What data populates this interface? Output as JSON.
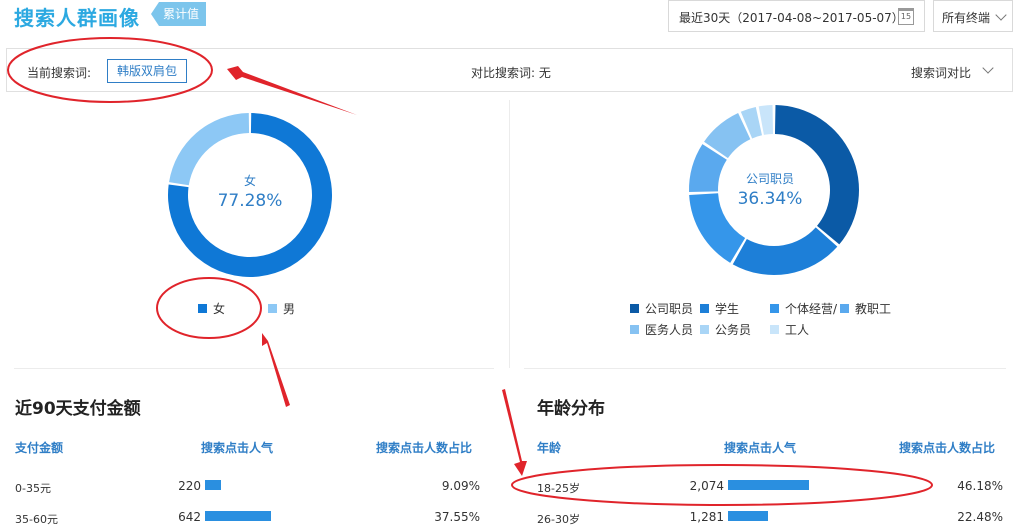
{
  "header": {
    "title": "搜索人群画像",
    "badge": "累计值",
    "date_range": "最近30天（2017-04-08~2017-05-07）",
    "calendar_day": "15",
    "terminal": "所有终端"
  },
  "search_bar": {
    "current_label": "当前搜索词:",
    "current_term": "韩版双肩包",
    "compare_label": "对比搜索词: 无",
    "compare_button": "搜索词对比"
  },
  "gender": {
    "center_category": "女",
    "center_percent": "77.28%",
    "slices": [
      {
        "name": "女",
        "value": 77.28,
        "color": "#0f78d6"
      },
      {
        "name": "男",
        "value": 22.72,
        "color": "#8dc8f5"
      }
    ]
  },
  "occupation": {
    "center_category": "公司职员",
    "center_percent": "36.34%",
    "slices": [
      {
        "name": "公司职员",
        "value": 36.34,
        "color": "#0b5aa6"
      },
      {
        "name": "学生",
        "value": 22.0,
        "color": "#1d7fd8"
      },
      {
        "name": "个体经营/",
        "value": 16.0,
        "color": "#3596ea"
      },
      {
        "name": "教职工",
        "value": 10.0,
        "color": "#5aa9ee"
      },
      {
        "name": "医务人员",
        "value": 9.0,
        "color": "#86c2f2"
      },
      {
        "name": "公务员",
        "value": 3.5,
        "color": "#a9d5f6"
      },
      {
        "name": "工人",
        "value": 3.16,
        "color": "#c9e5fa"
      }
    ]
  },
  "payment": {
    "title": "近90天支付金额",
    "headers": [
      "支付金额",
      "搜索点击人气",
      "搜索点击人数占比"
    ],
    "rows": [
      {
        "label": "0-35元",
        "value": "220",
        "percent": "9.09%",
        "ratio": 0.0909
      },
      {
        "label": "35-60元",
        "value": "642",
        "percent": "37.55%",
        "ratio": 0.3755
      }
    ]
  },
  "age": {
    "title": "年龄分布",
    "headers": [
      "年龄",
      "搜索点击人气",
      "搜索点击人数占比"
    ],
    "rows": [
      {
        "label": "18-25岁",
        "value": "2,074",
        "percent": "46.18%",
        "ratio": 0.4618
      },
      {
        "label": "26-30岁",
        "value": "1,281",
        "percent": "22.48%",
        "ratio": 0.2248
      }
    ]
  },
  "colors": {
    "accent": "#2f7ec6",
    "title": "#2ca9e1",
    "bar": "#2a8fe0",
    "annotation": "#e0242b"
  }
}
